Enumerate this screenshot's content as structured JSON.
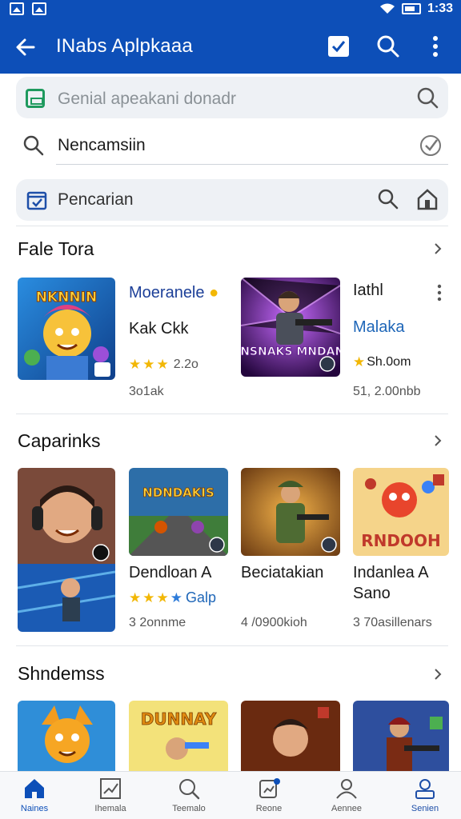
{
  "status_bar": {
    "time": "1:33"
  },
  "app_bar": {
    "title": "INabs Aplpkaaa"
  },
  "search": {
    "row1_text": "Genial apeakani donadr",
    "row2_text": "Nencamsiin",
    "row3_text": "Pencarian"
  },
  "sections": [
    {
      "title": "Fale Tora",
      "apps": [
        {
          "name": "Moeranele",
          "sub": "Kak Ckk",
          "rating_text": "2.2o",
          "stars": 3,
          "meta": "3o1ak"
        },
        {
          "name": "Iathl",
          "sub": "Malaka",
          "rating_text": "Sh.0om",
          "stars": 1,
          "meta": "51, 2.00nbb"
        }
      ]
    },
    {
      "title": "Caparinks",
      "apps": [
        {
          "name": "Dendloan A",
          "rating_text": "Galp",
          "stars": 4,
          "meta": "3  2onnme"
        },
        {
          "name": "Beciatakian",
          "meta": "4  /0900kioh"
        },
        {
          "name": "Indanlea A",
          "name_line2": "Sano",
          "meta": "3  70asillenars"
        }
      ],
      "image_titles": [
        "NDNDAKIS",
        "RNDOOH"
      ]
    },
    {
      "title": "Shndemss",
      "image_titles": [
        "DUNNAY"
      ]
    }
  ],
  "featured_images": {
    "first_title": "NKNNIN",
    "second_title": "MNSNAKS MNDANE"
  },
  "bottom_nav": [
    {
      "label": "Naines",
      "icon": "home-icon",
      "active": true
    },
    {
      "label": "Ihemala",
      "icon": "chart-icon",
      "active": false
    },
    {
      "label": "Teemalo",
      "icon": "search-icon",
      "active": false
    },
    {
      "label": "Reone",
      "icon": "notification-icon",
      "active": false
    },
    {
      "label": "Aennee",
      "icon": "people-icon",
      "active": false
    },
    {
      "label": "Senien",
      "icon": "user-icon",
      "active": false
    }
  ],
  "colors": {
    "primary": "#0d4fb8",
    "star": "#f2b705",
    "link": "#1e66b8"
  }
}
